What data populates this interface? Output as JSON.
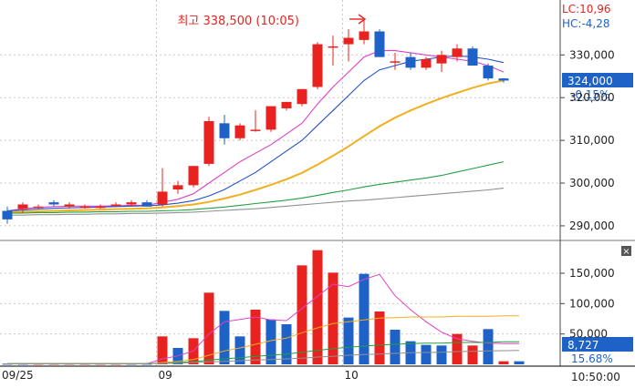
{
  "chart_data": [
    {
      "type": "candlestick",
      "panel": "price",
      "yticks": [
        290000,
        300000,
        310000,
        320000,
        330000
      ],
      "ytick_labels": [
        "290,000",
        "300,000",
        "310,000",
        "320,000",
        "330,000"
      ],
      "ylim": [
        287000,
        342000
      ],
      "candles": [
        {
          "o": 293500,
          "h": 294500,
          "l": 290500,
          "c": 291500
        },
        {
          "o": 294000,
          "h": 295500,
          "l": 293000,
          "c": 295000
        },
        {
          "o": 294500,
          "h": 295000,
          "l": 294000,
          "c": 294500
        },
        {
          "o": 295500,
          "h": 296000,
          "l": 294500,
          "c": 295000
        },
        {
          "o": 294500,
          "h": 295500,
          "l": 294000,
          "c": 295000
        },
        {
          "o": 294500,
          "h": 295000,
          "l": 294000,
          "c": 294500
        },
        {
          "o": 294500,
          "h": 295000,
          "l": 294000,
          "c": 294500
        },
        {
          "o": 295000,
          "h": 295500,
          "l": 294500,
          "c": 295000
        },
        {
          "o": 295000,
          "h": 296000,
          "l": 294500,
          "c": 295500
        },
        {
          "o": 295500,
          "h": 296000,
          "l": 294500,
          "c": 294500
        },
        {
          "o": 295000,
          "h": 303500,
          "l": 294500,
          "c": 298000
        },
        {
          "o": 298500,
          "h": 300500,
          "l": 297500,
          "c": 299500
        },
        {
          "o": 299500,
          "h": 304000,
          "l": 299000,
          "c": 304000
        },
        {
          "o": 304500,
          "h": 315500,
          "l": 304000,
          "c": 314500
        },
        {
          "o": 314000,
          "h": 316000,
          "l": 309000,
          "c": 310500
        },
        {
          "o": 310500,
          "h": 314000,
          "l": 310000,
          "c": 313500
        },
        {
          "o": 312500,
          "h": 317000,
          "l": 312000,
          "c": 312500
        },
        {
          "o": 312500,
          "h": 318000,
          "l": 312000,
          "c": 318000
        },
        {
          "o": 317500,
          "h": 319000,
          "l": 317000,
          "c": 319000
        },
        {
          "o": 318500,
          "h": 322000,
          "l": 318000,
          "c": 322000
        },
        {
          "o": 322500,
          "h": 333000,
          "l": 322000,
          "c": 332500
        },
        {
          "o": 332000,
          "h": 334500,
          "l": 327500,
          "c": 332000
        },
        {
          "o": 332500,
          "h": 336000,
          "l": 328500,
          "c": 334000
        },
        {
          "o": 333500,
          "h": 338500,
          "l": 332500,
          "c": 335500
        },
        {
          "o": 335500,
          "h": 336000,
          "l": 329500,
          "c": 329500
        },
        {
          "o": 328500,
          "h": 330500,
          "l": 326500,
          "c": 328500
        },
        {
          "o": 329500,
          "h": 330500,
          "l": 326500,
          "c": 327000
        },
        {
          "o": 327000,
          "h": 329500,
          "l": 326500,
          "c": 329000
        },
        {
          "o": 328000,
          "h": 331000,
          "l": 326000,
          "c": 330000
        },
        {
          "o": 329500,
          "h": 332500,
          "l": 328500,
          "c": 331500
        },
        {
          "o": 331500,
          "h": 332000,
          "l": 327500,
          "c": 327500
        },
        {
          "o": 327500,
          "h": 328000,
          "l": 324000,
          "c": 324500
        },
        {
          "o": 324500,
          "h": 324500,
          "l": 323500,
          "c": 324000
        }
      ],
      "ma_series": [
        {
          "color": "#e040c8",
          "values": [
            293500,
            294000,
            294300,
            294500,
            294600,
            294600,
            294600,
            294700,
            294800,
            294800,
            295500,
            296200,
            297500,
            300000,
            302500,
            305000,
            307000,
            309000,
            311500,
            314000,
            318500,
            322500,
            326000,
            329500,
            331000,
            331000,
            330500,
            330000,
            329500,
            329000,
            328500,
            327500,
            326000
          ]
        },
        {
          "color": "#2450c8",
          "values": [
            293500,
            293700,
            293900,
            294100,
            294200,
            294300,
            294400,
            294500,
            294600,
            294700,
            294900,
            295300,
            295900,
            297000,
            298500,
            300500,
            302500,
            305000,
            307500,
            310000,
            313500,
            317000,
            320500,
            324000,
            326500,
            327500,
            328500,
            329000,
            329500,
            329800,
            329500,
            329000,
            328200
          ]
        },
        {
          "color": "#f0b020",
          "values": [
            293200,
            293300,
            293400,
            293500,
            293600,
            293700,
            293800,
            293900,
            294000,
            294100,
            294300,
            294600,
            295000,
            295600,
            296400,
            297300,
            298400,
            299600,
            300900,
            302400,
            304300,
            306400,
            308600,
            311000,
            313300,
            315300,
            317000,
            318500,
            319900,
            321100,
            322300,
            323300,
            324000
          ]
        },
        {
          "color": "#22a040",
          "values": [
            293000,
            293000,
            293100,
            293100,
            293200,
            293200,
            293300,
            293300,
            293400,
            293400,
            293500,
            293600,
            293800,
            294100,
            294400,
            294800,
            295200,
            295600,
            296000,
            296500,
            297100,
            297800,
            298400,
            299100,
            299700,
            300200,
            300700,
            301200,
            301800,
            302600,
            303400,
            304200,
            305000
          ]
        },
        {
          "color": "#909090",
          "values": [
            292500,
            292500,
            292600,
            292600,
            292700,
            292700,
            292800,
            292800,
            292900,
            292900,
            293000,
            293100,
            293200,
            293400,
            293600,
            293800,
            294000,
            294300,
            294600,
            294900,
            295200,
            295500,
            295800,
            296000,
            296300,
            296600,
            296900,
            297200,
            297500,
            297800,
            298100,
            298400,
            298800
          ]
        }
      ],
      "high_annotation": "최고 338,500 (10:05)",
      "lc_label": "LC:10,96",
      "hc_label": "HC:-4,28",
      "current_price": "324,000",
      "current_change": "-0.15%"
    },
    {
      "type": "bar",
      "panel": "volume",
      "yticks": [
        50000,
        100000,
        150000
      ],
      "ytick_labels": [
        "50,000",
        "100,000",
        "150,000"
      ],
      "ylim": [
        0,
        195000
      ],
      "colors": [
        "blue",
        "blue",
        "red",
        "red",
        "red",
        "red",
        "red",
        "red",
        "blue",
        "blue",
        "red",
        "blue",
        "red",
        "red",
        "blue",
        "blue",
        "red",
        "blue",
        "blue",
        "red",
        "red",
        "red",
        "blue",
        "blue",
        "red",
        "blue",
        "blue",
        "blue",
        "blue",
        "red",
        "red",
        "blue",
        "red",
        "blue"
      ],
      "values": [
        1000,
        1000,
        1000,
        1000,
        1000,
        1000,
        1000,
        1000,
        1000,
        1000,
        46000,
        27000,
        43000,
        118000,
        88000,
        46000,
        90000,
        74000,
        66000,
        163000,
        188000,
        151000,
        77000,
        149000,
        87000,
        57000,
        38000,
        32000,
        31000,
        50000,
        31000,
        58000,
        5000,
        5000
      ],
      "ma_series": [
        {
          "color": "#e040c8",
          "values": [
            1000,
            1000,
            1000,
            1000,
            1000,
            1000,
            1000,
            1000,
            1000,
            1000,
            9000,
            14000,
            22000,
            50000,
            70000,
            74000,
            78000,
            73000,
            72000,
            92000,
            112000,
            132000,
            128000,
            140000,
            148000,
            113000,
            90000,
            70000,
            53000,
            42000,
            38000,
            35000,
            34000,
            34000
          ]
        },
        {
          "color": "#f0b020",
          "values": [
            1000,
            1000,
            1000,
            1000,
            1000,
            1000,
            1000,
            1000,
            1000,
            1000,
            3000,
            5000,
            8000,
            15000,
            22000,
            27000,
            33000,
            39000,
            43000,
            52000,
            60000,
            67000,
            70000,
            73000,
            76000,
            77000,
            78000,
            78000,
            78000,
            79000,
            79000,
            79000,
            80000,
            80000
          ]
        },
        {
          "color": "#22a040",
          "values": [
            1000,
            1000,
            1000,
            1000,
            1000,
            1000,
            1000,
            1000,
            1000,
            1000,
            2000,
            3000,
            4000,
            7000,
            9000,
            11000,
            13000,
            15000,
            17000,
            20000,
            23000,
            26000,
            28000,
            30000,
            32000,
            33000,
            34000,
            35000,
            35000,
            36000,
            36000,
            36000,
            37000,
            37000
          ]
        },
        {
          "color": "#909090",
          "values": [
            1000,
            1000,
            1000,
            1000,
            1000,
            1000,
            1000,
            1000,
            1000,
            1000,
            1500,
            2000,
            3000,
            4000,
            5000,
            6000,
            7000,
            8000,
            9000,
            10000,
            12000,
            13000,
            15000,
            16000,
            17000,
            18000,
            19000,
            19500,
            20000,
            21000,
            21500,
            22000,
            22500,
            23000
          ]
        }
      ],
      "current_volume": "8,727",
      "current_pct": "15.68%"
    }
  ],
  "x_axis": {
    "labels": [
      {
        "text": "09/25",
        "slot": 0
      },
      {
        "text": "09",
        "slot": 10
      },
      {
        "text": "10",
        "slot": 22
      }
    ],
    "time_label": "10:50:00"
  }
}
